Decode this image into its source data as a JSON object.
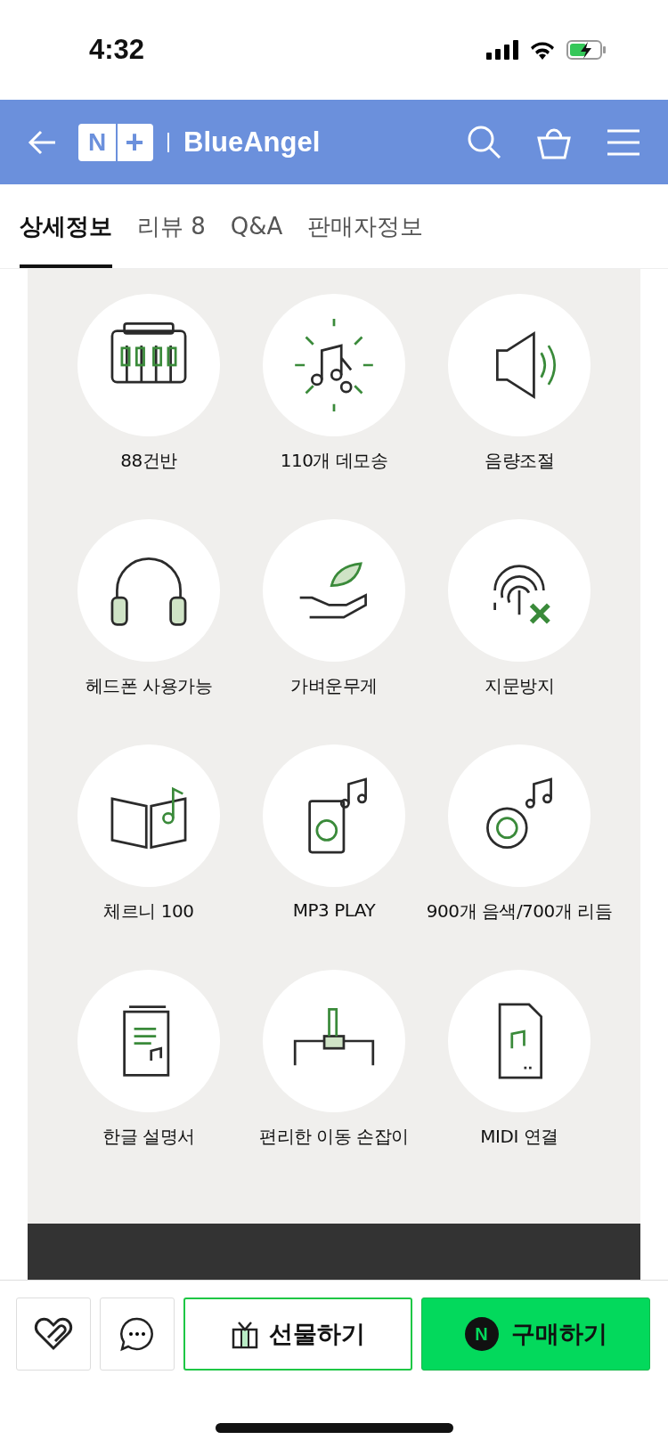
{
  "status_bar": {
    "time": "4:32"
  },
  "header": {
    "logo": "N",
    "logo_plus": "+",
    "store_name": "BlueAngel"
  },
  "tabs": [
    {
      "label": "상세정보",
      "selected": true
    },
    {
      "label": "리뷰 8",
      "selected": false
    },
    {
      "label": "Q&A",
      "selected": false
    },
    {
      "label": "판매자정보",
      "selected": false
    }
  ],
  "features": [
    {
      "label": "88건반"
    },
    {
      "label": "110개 데모송"
    },
    {
      "label": "음량조절"
    },
    {
      "label": "헤드폰 사용가능"
    },
    {
      "label": "가벼운무게"
    },
    {
      "label": "지문방지"
    },
    {
      "label": "체르니 100"
    },
    {
      "label": "MP3 PLAY"
    },
    {
      "label": "900개 음색/700개 리듬"
    },
    {
      "label": "한글 설명서"
    },
    {
      "label": "편리한 이동 손잡이"
    },
    {
      "label": "MIDI 연결"
    }
  ],
  "bottom_bar": {
    "gift_button": "선물하기",
    "buy_button": "구매하기",
    "buy_logo": "N"
  }
}
